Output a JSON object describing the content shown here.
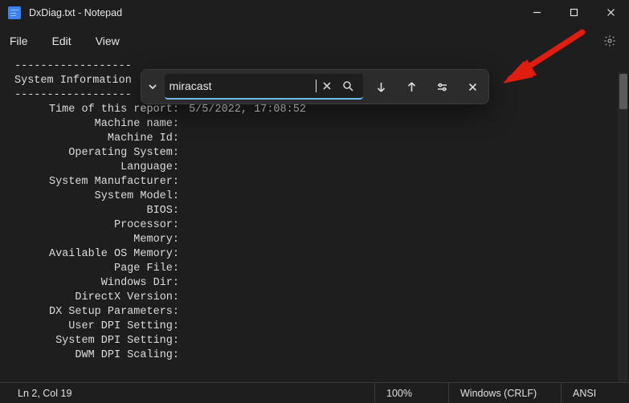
{
  "window": {
    "title": "DxDiag.txt - Notepad"
  },
  "menu": {
    "file": "File",
    "edit": "Edit",
    "view": "View"
  },
  "find": {
    "value": "miracast"
  },
  "body": {
    "dashes": "------------------",
    "heading": "System Information",
    "report_key": "Time of this report:",
    "report_val": " 5/5/2022, 17:08:52",
    "keys": [
      "Machine name:",
      "Machine Id:",
      "Operating System:",
      "Language:",
      "System Manufacturer:",
      "System Model:",
      "BIOS:",
      "Processor:",
      "Memory:",
      "Available OS Memory:",
      "Page File:",
      "Windows Dir:",
      "DirectX Version:",
      "DX Setup Parameters:",
      "User DPI Setting:",
      "System DPI Setting:",
      "DWM DPI Scaling:"
    ]
  },
  "status": {
    "pos": "Ln 2, Col 19",
    "zoom": "100%",
    "eol": "Windows (CRLF)",
    "enc": "ANSI"
  },
  "colors": {
    "accent": "#6fb7ff",
    "bg": "#1e1e1e",
    "arrow": "#e11d0f"
  }
}
